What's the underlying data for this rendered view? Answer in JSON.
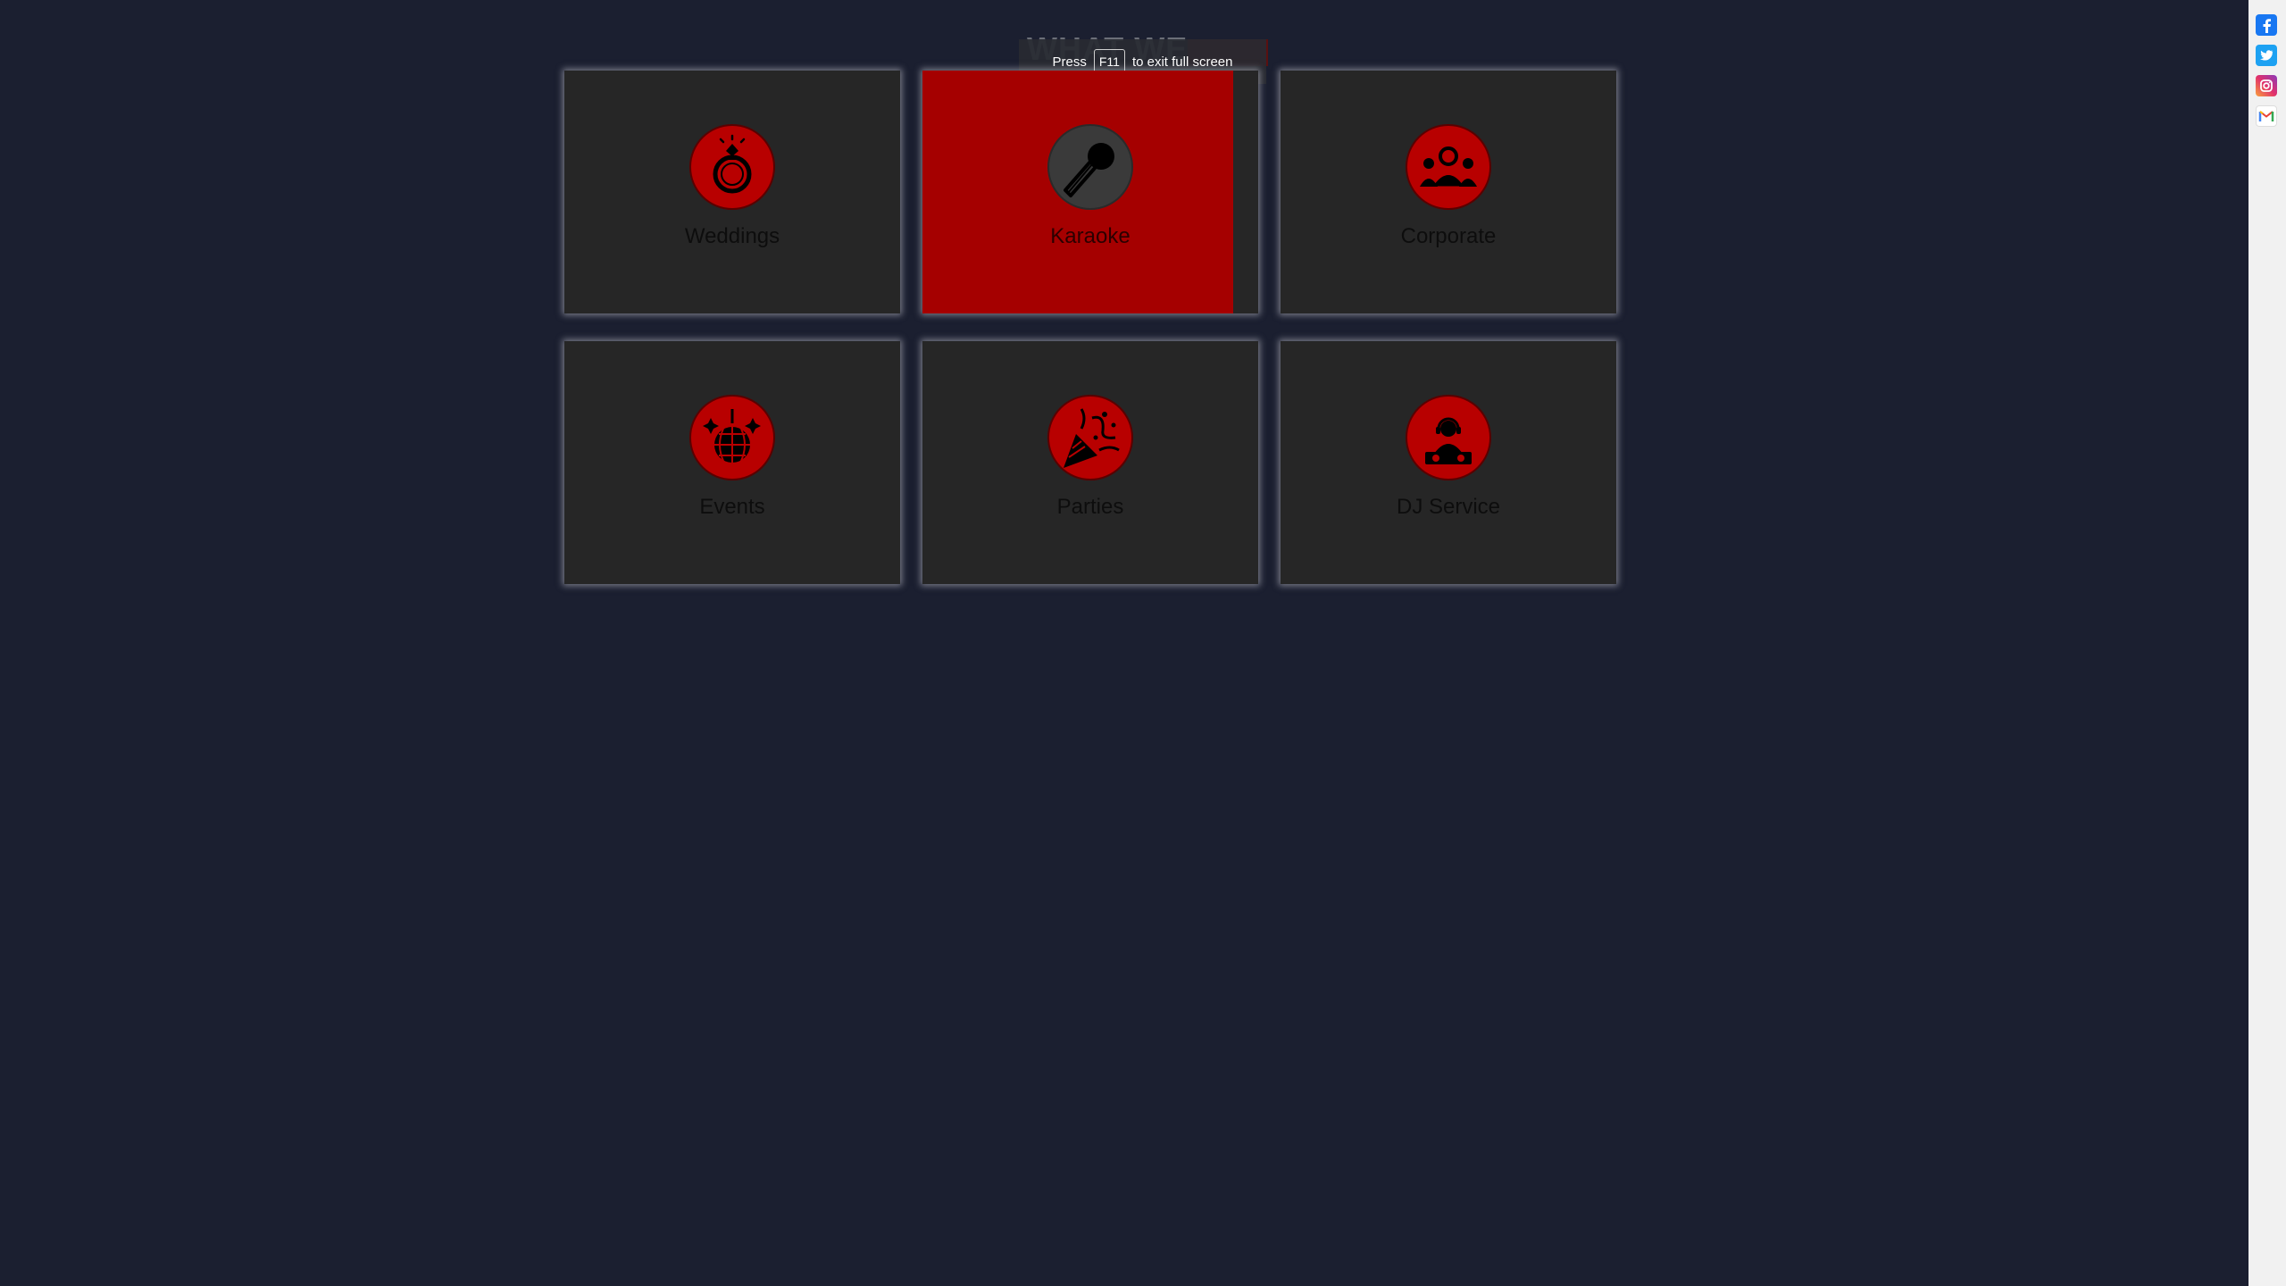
{
  "section": {
    "heading": "WHAT WE"
  },
  "fullscreen_toast": {
    "prefix": "Press",
    "key": "F11",
    "suffix": "to exit full screen"
  },
  "services": [
    {
      "label": "Weddings",
      "icon": "ring-icon"
    },
    {
      "label": "Karaoke",
      "icon": "microphone-icon",
      "state": "hover"
    },
    {
      "label": "Corporate",
      "icon": "people-icon"
    },
    {
      "label": "Events",
      "icon": "disco-ball-icon"
    },
    {
      "label": "Parties",
      "icon": "party-popper-icon"
    },
    {
      "label": "DJ Service",
      "icon": "dj-icon"
    }
  ],
  "social_links": [
    {
      "icon": "facebook-icon"
    },
    {
      "icon": "twitter-icon"
    },
    {
      "icon": "instagram-icon"
    },
    {
      "icon": "gmail-icon"
    }
  ],
  "colors": {
    "background": "#1b1f30",
    "card": "#262626",
    "accent": "#a50000",
    "icon_circle": "#b80000"
  }
}
